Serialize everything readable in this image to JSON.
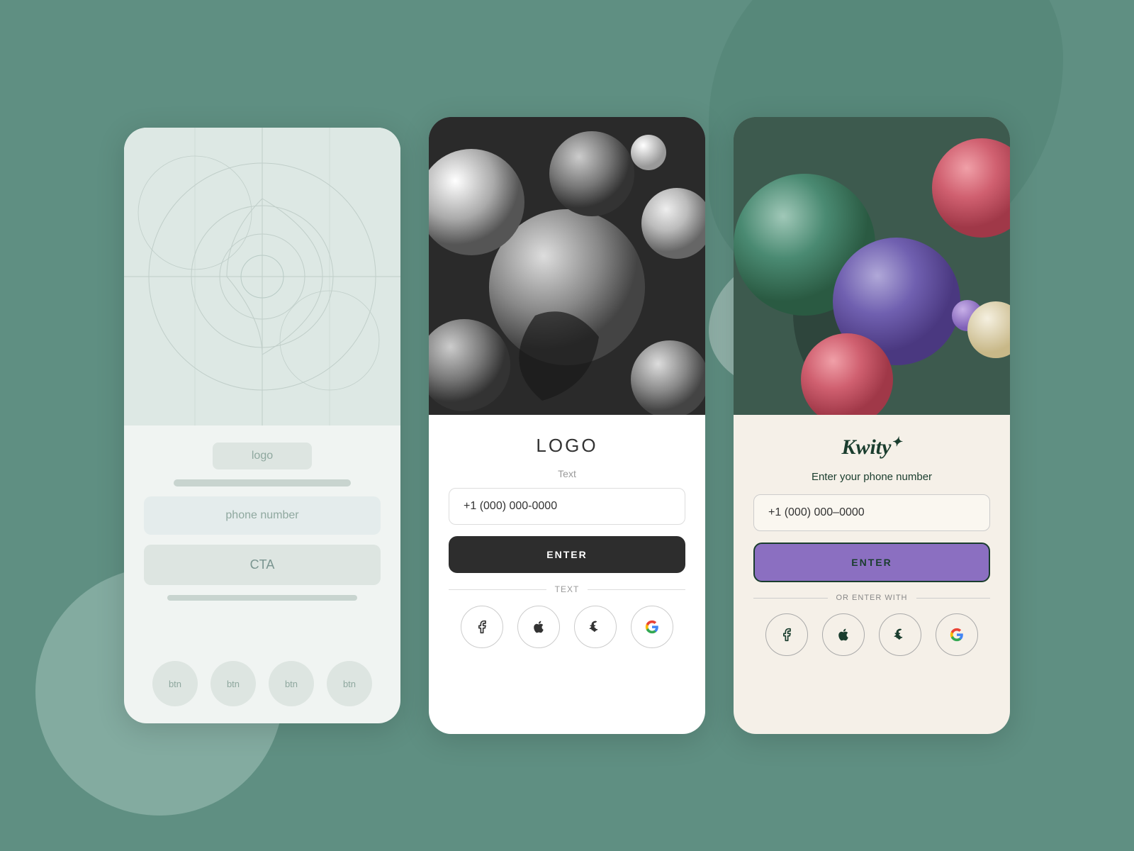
{
  "background": {
    "color": "#5f8f82"
  },
  "card1": {
    "type": "wireframe",
    "logo_label": "logo",
    "input_label": "phone number",
    "cta_label": "CTA",
    "btn_labels": [
      "btn",
      "btn",
      "btn",
      "btn"
    ]
  },
  "card2": {
    "type": "grayscale",
    "logo": "LOGO",
    "text_label": "Text",
    "input_placeholder": "+1 (000) 000-0000",
    "enter_label": "ENTER",
    "divider_text": "TEXT",
    "social_icons": [
      "facebook",
      "apple",
      "snapchat",
      "google"
    ]
  },
  "card3": {
    "type": "colored",
    "logo": "Kwity",
    "logo_suffix": "✦",
    "phone_label": "Enter your phone number",
    "input_placeholder": "+1 (000) 000–0000",
    "enter_label": "ENTER",
    "divider_text": "OR ENTER WITH",
    "social_icons": [
      "facebook",
      "apple",
      "snapchat",
      "google"
    ]
  }
}
